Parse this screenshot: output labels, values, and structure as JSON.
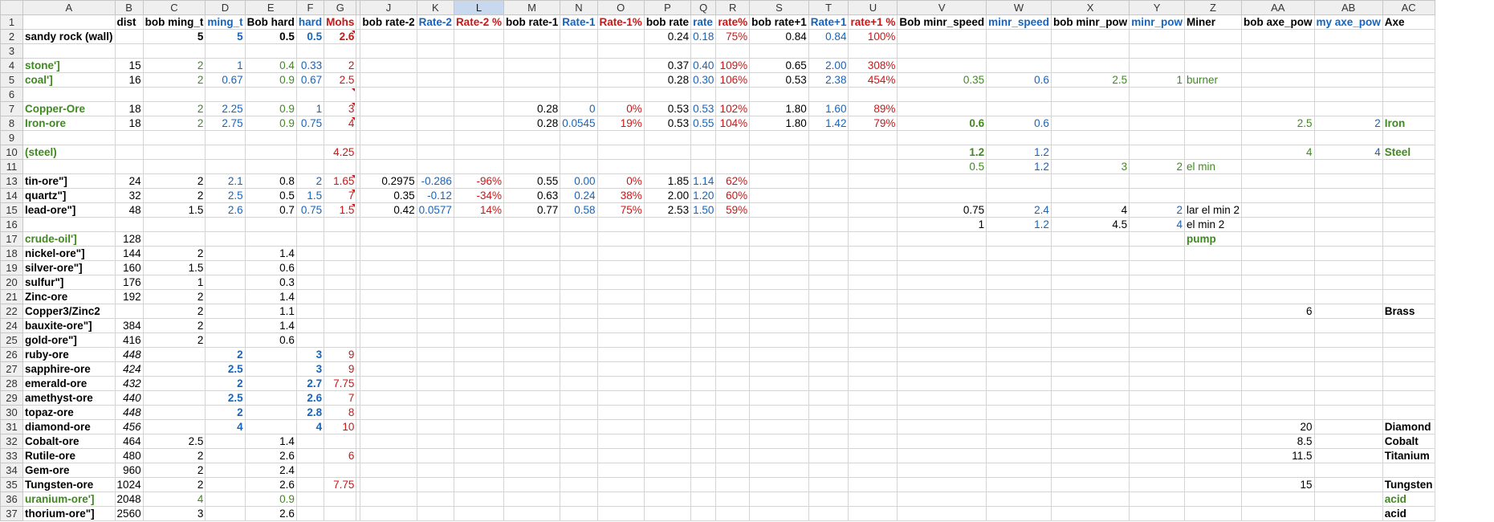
{
  "columns": [
    "A",
    "B",
    "C",
    "D",
    "E",
    "F",
    "G",
    "",
    "J",
    "K",
    "L",
    "M",
    "N",
    "O",
    "P",
    "Q",
    "R",
    "S",
    "T",
    "U",
    "V",
    "W",
    "X",
    "Y",
    "Z",
    "AA",
    "AB",
    "AC"
  ],
  "rows": [
    {
      "n": "1",
      "cells": [
        "",
        "dist",
        "bob ming_t",
        "ming_t",
        "Bob hard",
        "hard",
        "Mohs",
        "",
        "bob rate-2",
        "Rate-2",
        "Rate-2 %",
        "bob rate-1",
        "Rate-1",
        "Rate-1%",
        "bob rate",
        "rate",
        "rate%",
        "bob rate+1",
        "Rate+1",
        "rate+1 %",
        "Bob minr_speed",
        "minr_speed",
        "bob minr_pow",
        "minr_pow",
        "Miner",
        "bob axe_pow",
        "my axe_pow",
        "Axe"
      ]
    },
    {
      "n": "2",
      "cells": [
        "sandy rock (wall)",
        "",
        "5",
        "5",
        "0.5",
        "0.5",
        "2.6",
        "",
        "",
        "",
        "",
        "",
        "",
        "",
        "0.24",
        "0.18",
        "75%",
        "0.84",
        "0.84",
        "100%",
        "",
        "",
        "",
        "",
        "",
        "",
        "",
        ""
      ]
    },
    {
      "n": "3",
      "cells": [
        "",
        "",
        "",
        "",
        "",
        "",
        "",
        "",
        "",
        "",
        "",
        "",
        "",
        "",
        "",
        "",
        "",
        "",
        "",
        "",
        "",
        "",
        "",
        "",
        "",
        "",
        "",
        ""
      ]
    },
    {
      "n": "4",
      "cells": [
        "stone']",
        "15",
        "2",
        "1",
        "0.4",
        "0.33",
        "2",
        "",
        "",
        "",
        "",
        "",
        "",
        "",
        "0.37",
        "0.40",
        "109%",
        "0.65",
        "2.00",
        "308%",
        "",
        "",
        "",
        "",
        "",
        "",
        "",
        ""
      ]
    },
    {
      "n": "5",
      "cells": [
        "coal']",
        "16",
        "2",
        "0.67",
        "0.9",
        "0.67",
        "2.5",
        "",
        "",
        "",
        "",
        "",
        "",
        "",
        "0.28",
        "0.30",
        "106%",
        "0.53",
        "2.38",
        "454%",
        "0.35",
        "0.6",
        "2.5",
        "1",
        "burner",
        "",
        "",
        ""
      ]
    },
    {
      "n": "6",
      "cells": [
        "",
        "",
        "",
        "",
        "",
        "",
        "",
        "",
        "",
        "",
        "",
        "",
        "",
        "",
        "",
        "",
        "",
        "",
        "",
        "",
        "",
        "",
        "",
        "",
        "",
        "",
        "",
        ""
      ]
    },
    {
      "n": "7",
      "cells": [
        "Copper-Ore",
        "18",
        "2",
        "2.25",
        "0.9",
        "1",
        "3",
        "",
        "",
        "",
        "",
        "0.28",
        "0",
        "0%",
        "0.53",
        "0.53",
        "102%",
        "1.80",
        "1.60",
        "89%",
        "",
        "",
        "",
        "",
        "",
        "",
        "",
        ""
      ]
    },
    {
      "n": "8",
      "cells": [
        "Iron-ore",
        "18",
        "2",
        "2.75",
        "0.9",
        "0.75",
        "4",
        "",
        "",
        "",
        "",
        "0.28",
        "0.0545",
        "19%",
        "0.53",
        "0.55",
        "104%",
        "1.80",
        "1.42",
        "79%",
        "0.6",
        "0.6",
        "",
        "",
        "",
        "2.5",
        "2",
        "Iron"
      ]
    },
    {
      "n": "9",
      "cells": [
        "",
        "",
        "",
        "",
        "",
        "",
        "",
        "",
        "",
        "",
        "",
        "",
        "",
        "",
        "",
        "",
        "",
        "",
        "",
        "",
        "",
        "",
        "",
        "",
        "",
        "",
        "",
        ""
      ]
    },
    {
      "n": "10",
      "cells": [
        "(steel)",
        "",
        "",
        "",
        "",
        "",
        "4.25",
        "",
        "",
        "",
        "",
        "",
        "",
        "",
        "",
        "",
        "",
        "",
        "",
        "",
        "1.2",
        "1.2",
        "",
        "",
        "",
        "4",
        "4",
        "Steel"
      ]
    },
    {
      "n": "11",
      "cells": [
        "",
        "",
        "",
        "",
        "",
        "",
        "",
        "",
        "",
        "",
        "",
        "",
        "",
        "",
        "",
        "",
        "",
        "",
        "",
        "",
        "0.5",
        "1.2",
        "3",
        "2",
        "el min",
        "",
        "",
        ""
      ]
    },
    {
      "n": "13",
      "cells": [
        "tin-ore\"]",
        "24",
        "2",
        "2.1",
        "0.8",
        "2",
        "1.65",
        "",
        "0.2975",
        "-0.286",
        "-96%",
        "0.55",
        "0.00",
        "0%",
        "1.85",
        "1.14",
        "62%",
        "",
        "",
        "",
        "",
        "",
        "",
        "",
        "",
        "",
        "",
        ""
      ]
    },
    {
      "n": "14",
      "cells": [
        "quartz\"]",
        "32",
        "2",
        "2.5",
        "0.5",
        "1.5",
        "7",
        "",
        "0.35",
        "-0.12",
        "-34%",
        "0.63",
        "0.24",
        "38%",
        "2.00",
        "1.20",
        "60%",
        "",
        "",
        "",
        "",
        "",
        "",
        "",
        "",
        "",
        "",
        ""
      ]
    },
    {
      "n": "15",
      "cells": [
        "lead-ore\"]",
        "48",
        "1.5",
        "2.6",
        "0.7",
        "0.75",
        "1.5",
        "",
        "0.42",
        "0.0577",
        "14%",
        "0.77",
        "0.58",
        "75%",
        "2.53",
        "1.50",
        "59%",
        "",
        "",
        "",
        "0.75",
        "2.4",
        "4",
        "2",
        "lar el min 2",
        "",
        "",
        ""
      ]
    },
    {
      "n": "16",
      "cells": [
        "",
        "",
        "",
        "",
        "",
        "",
        "",
        "",
        "",
        "",
        "",
        "",
        "",
        "",
        "",
        "",
        "",
        "",
        "",
        "",
        "1",
        "1.2",
        "4.5",
        "4",
        "el min 2",
        "",
        "",
        ""
      ]
    },
    {
      "n": "17",
      "cells": [
        "crude-oil']",
        "128",
        "",
        "",
        "",
        "",
        "",
        "",
        "",
        "",
        "",
        "",
        "",
        "",
        "",
        "",
        "",
        "",
        "",
        "",
        "",
        "",
        "",
        "",
        "pump",
        "",
        "",
        ""
      ]
    },
    {
      "n": "18",
      "cells": [
        "nickel-ore\"]",
        "144",
        "2",
        "",
        "1.4",
        "",
        "",
        "",
        "",
        "",
        "",
        "",
        "",
        "",
        "",
        "",
        "",
        "",
        "",
        "",
        "",
        "",
        "",
        "",
        "",
        "",
        "",
        ""
      ]
    },
    {
      "n": "19",
      "cells": [
        "silver-ore\"]",
        "160",
        "1.5",
        "",
        "0.6",
        "",
        "",
        "",
        "",
        "",
        "",
        "",
        "",
        "",
        "",
        "",
        "",
        "",
        "",
        "",
        "",
        "",
        "",
        "",
        "",
        "",
        "",
        ""
      ]
    },
    {
      "n": "20",
      "cells": [
        "sulfur\"]",
        "176",
        "1",
        "",
        "0.3",
        "",
        "",
        "",
        "",
        "",
        "",
        "",
        "",
        "",
        "",
        "",
        "",
        "",
        "",
        "",
        "",
        "",
        "",
        "",
        "",
        "",
        "",
        ""
      ]
    },
    {
      "n": "21",
      "cells": [
        "Zinc-ore",
        "192",
        "2",
        "",
        "1.4",
        "",
        "",
        "",
        "",
        "",
        "",
        "",
        "",
        "",
        "",
        "",
        "",
        "",
        "",
        "",
        "",
        "",
        "",
        "",
        "",
        "",
        "",
        ""
      ]
    },
    {
      "n": "22",
      "cells": [
        "Copper3/Zinc2",
        "",
        "2",
        "",
        "1.1",
        "",
        "",
        "",
        "",
        "",
        "",
        "",
        "",
        "",
        "",
        "",
        "",
        "",
        "",
        "",
        "",
        "",
        "",
        "",
        "",
        "6",
        "",
        "Brass"
      ]
    },
    {
      "n": "24",
      "cells": [
        "bauxite-ore\"]",
        "384",
        "2",
        "",
        "1.4",
        "",
        "",
        "",
        "",
        "",
        "",
        "",
        "",
        "",
        "",
        "",
        "",
        "",
        "",
        "",
        "",
        "",
        "",
        "",
        "",
        "",
        "",
        ""
      ]
    },
    {
      "n": "25",
      "cells": [
        "gold-ore\"]",
        "416",
        "2",
        "",
        "0.6",
        "",
        "",
        "",
        "",
        "",
        "",
        "",
        "",
        "",
        "",
        "",
        "",
        "",
        "",
        "",
        "",
        "",
        "",
        "",
        "",
        "",
        "",
        ""
      ]
    },
    {
      "n": "26",
      "cells": [
        "ruby-ore",
        "448",
        "",
        "2",
        "",
        "3",
        "9",
        "",
        "",
        "",
        "",
        "",
        "",
        "",
        "",
        "",
        "",
        "",
        "",
        "",
        "",
        "",
        "",
        "",
        "",
        "",
        "",
        ""
      ]
    },
    {
      "n": "27",
      "cells": [
        "sapphire-ore",
        "424",
        "",
        "2.5",
        "",
        "3",
        "9",
        "",
        "",
        "",
        "",
        "",
        "",
        "",
        "",
        "",
        "",
        "",
        "",
        "",
        "",
        "",
        "",
        "",
        "",
        "",
        "",
        ""
      ]
    },
    {
      "n": "28",
      "cells": [
        "emerald-ore",
        "432",
        "",
        "2",
        "",
        "2.7",
        "7.75",
        "",
        "",
        "",
        "",
        "",
        "",
        "",
        "",
        "",
        "",
        "",
        "",
        "",
        "",
        "",
        "",
        "",
        "",
        "",
        "",
        ""
      ]
    },
    {
      "n": "29",
      "cells": [
        "amethyst-ore",
        "440",
        "",
        "2.5",
        "",
        "2.6",
        "7",
        "",
        "",
        "",
        "",
        "",
        "",
        "",
        "",
        "",
        "",
        "",
        "",
        "",
        "",
        "",
        "",
        "",
        "",
        "",
        "",
        ""
      ]
    },
    {
      "n": "30",
      "cells": [
        "topaz-ore",
        "448",
        "",
        "2",
        "",
        "2.8",
        "8",
        "",
        "",
        "",
        "",
        "",
        "",
        "",
        "",
        "",
        "",
        "",
        "",
        "",
        "",
        "",
        "",
        "",
        "",
        "",
        "",
        ""
      ]
    },
    {
      "n": "31",
      "cells": [
        "diamond-ore",
        "456",
        "",
        "4",
        "",
        "4",
        "10",
        "",
        "",
        "",
        "",
        "",
        "",
        "",
        "",
        "",
        "",
        "",
        "",
        "",
        "",
        "",
        "",
        "",
        "",
        "20",
        "",
        "Diamond"
      ]
    },
    {
      "n": "32",
      "cells": [
        "Cobalt-ore",
        "464",
        "2.5",
        "",
        "1.4",
        "",
        "",
        "",
        "",
        "",
        "",
        "",
        "",
        "",
        "",
        "",
        "",
        "",
        "",
        "",
        "",
        "",
        "",
        "",
        "",
        "8.5",
        "",
        "Cobalt"
      ]
    },
    {
      "n": "33",
      "cells": [
        "Rutile-ore",
        "480",
        "2",
        "",
        "2.6",
        "",
        "6",
        "",
        "",
        "",
        "",
        "",
        "",
        "",
        "",
        "",
        "",
        "",
        "",
        "",
        "",
        "",
        "",
        "",
        "",
        "11.5",
        "",
        "Titanium"
      ]
    },
    {
      "n": "34",
      "cells": [
        "Gem-ore",
        "960",
        "2",
        "",
        "2.4",
        "",
        "",
        "",
        "",
        "",
        "",
        "",
        "",
        "",
        "",
        "",
        "",
        "",
        "",
        "",
        "",
        "",
        "",
        "",
        "",
        "",
        "",
        ""
      ]
    },
    {
      "n": "35",
      "cells": [
        "Tungsten-ore",
        "1024",
        "2",
        "",
        "2.6",
        "",
        "7.75",
        "",
        "",
        "",
        "",
        "",
        "",
        "",
        "",
        "",
        "",
        "",
        "",
        "",
        "",
        "",
        "",
        "",
        "",
        "15",
        "",
        "Tungsten"
      ]
    },
    {
      "n": "36",
      "cells": [
        "uranium-ore']",
        "2048",
        "4",
        "",
        "0.9",
        "",
        "",
        "",
        "",
        "",
        "",
        "",
        "",
        "",
        "",
        "",
        "",
        "",
        "",
        "",
        "",
        "",
        "",
        "",
        "",
        "",
        "",
        "acid"
      ]
    },
    {
      "n": "37",
      "cells": [
        "thorium-ore\"]",
        "2560",
        "3",
        "",
        "2.6",
        "",
        "",
        "",
        "",
        "",
        "",
        "",
        "",
        "",
        "",
        "",
        "",
        "",
        "",
        "",
        "",
        "",
        "",
        "",
        "",
        "",
        "",
        "acid"
      ]
    }
  ]
}
